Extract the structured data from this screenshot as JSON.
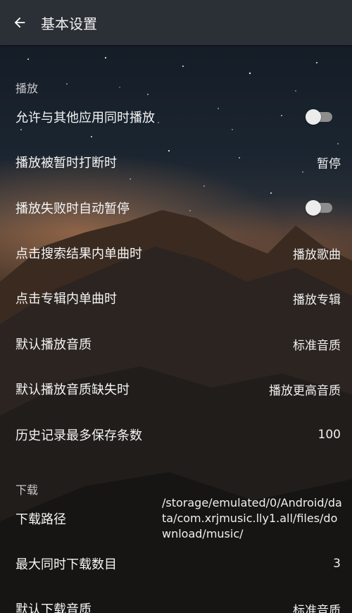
{
  "header": {
    "title": "基本设置",
    "back_icon": "arrow-left-icon"
  },
  "sections": [
    {
      "name": "播放"
    },
    {
      "name": "下载"
    }
  ],
  "playback": {
    "allow_concurrent": {
      "label": "允许与其他应用同时播放",
      "on": false
    },
    "on_interrupt": {
      "label": "播放被暂时打断时",
      "value": "暂停"
    },
    "auto_pause_on_fail": {
      "label": "播放失败时自动暂停",
      "on": false
    },
    "search_single_click": {
      "label": "点击搜索结果内单曲时",
      "value": "播放歌曲"
    },
    "album_single_click": {
      "label": "点击专辑内单曲时",
      "value": "播放专辑"
    },
    "default_quality": {
      "label": "默认播放音质",
      "value": "标准音质"
    },
    "quality_missing": {
      "label": "默认播放音质缺失时",
      "value": "播放更高音质"
    },
    "history_max": {
      "label": "历史记录最多保存条数",
      "value": "100"
    }
  },
  "download": {
    "path": {
      "label": "下载路径",
      "value": "/storage/emulated/0/Android/data/com.xrjmusic.lly1.all/files/download/music/"
    },
    "max_concurrent": {
      "label": "最大同时下载数目",
      "value": "3"
    },
    "default_quality": {
      "label": "默认下载音质",
      "value": "标准音质"
    }
  },
  "colors": {
    "appbar": "#2b2f36",
    "toggle_track": "#8d8d8d",
    "toggle_knob": "#ececec"
  }
}
